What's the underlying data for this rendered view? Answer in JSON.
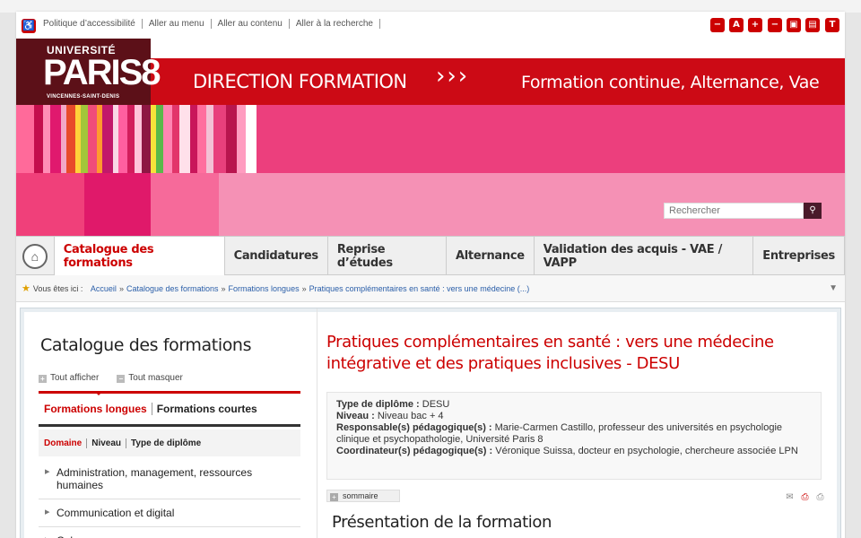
{
  "utility": {
    "links": [
      "Politique d’accessibilité",
      "Aller au menu",
      "Aller au contenu",
      "Aller à la recherche"
    ],
    "tool_icons": [
      "minus-icon",
      "text-a-icon",
      "plus-icon",
      "minimize-icon",
      "print-layout-icon",
      "split-layout-icon",
      "text-t-icon"
    ],
    "tool_glyphs": [
      "−",
      "A",
      "+",
      "−",
      "▣",
      "▤",
      "T"
    ]
  },
  "banner": {
    "logo_top": "UNIVERSITÉ",
    "logo_main": "PARIS8",
    "logo_sub": "VINCENNES-SAINT-DENIS",
    "title": "DIRECTION FORMATION",
    "arrows": "›››",
    "tagline": "Formation continue, Alternance, Vae",
    "colors": {
      "red": "#cc0a15",
      "pink": "#ec3f7d",
      "logo_bg": "#5c1018"
    }
  },
  "search": {
    "placeholder": "Rechercher"
  },
  "nav": {
    "tabs": [
      "Catalogue des formations",
      "Candidatures",
      "Reprise d’études",
      "Alternance",
      "Validation des acquis - VAE / VAPP",
      "Entreprises"
    ],
    "active": "Catalogue des formations"
  },
  "breadcrumb": {
    "prefix": "Vous êtes ici :",
    "items": [
      "Accueil",
      "Catalogue des formations",
      "Formations longues",
      "Pratiques complémentaires en santé : vers une médecine (...)"
    ]
  },
  "sidebar": {
    "title": "Catalogue des formations",
    "show_all": "Tout afficher",
    "hide_all": "Tout masquer",
    "tab_long": "Formations longues",
    "tab_short": "Formations courtes",
    "filters": [
      "Domaine",
      "Niveau",
      "Type de diplôme"
    ],
    "domains": [
      "Administration, management, ressources humaines",
      "Communication et digital",
      "Cul..."
    ]
  },
  "main": {
    "title": "Pratiques complémentaires en santé : vers une médecine intégrative et des pratiques inclusives - DESU",
    "info": [
      {
        "label": "Type de diplôme :",
        "value": "DESU"
      },
      {
        "label": "Niveau :",
        "value": "Niveau bac + 4"
      },
      {
        "label": "Responsable(s) pédagogique(s) :",
        "value": "Marie-Carmen Castillo, professeur des universités en psychologie clinique et psychopathologie, Université Paris 8"
      },
      {
        "label": "Coordinateur(s) pédagogique(s) :",
        "value": "Véronique Suissa, docteur en psychologie, chercheure associée LPN"
      }
    ],
    "sommaire": "sommaire",
    "section_title": "Présentation de la formation"
  }
}
